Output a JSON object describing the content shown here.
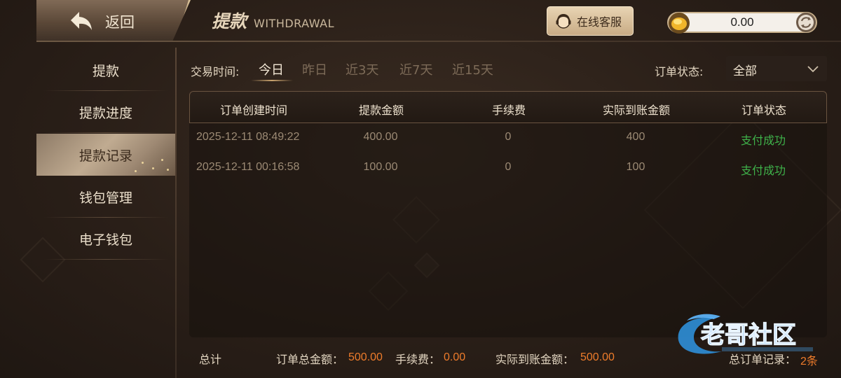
{
  "header": {
    "back_label": "返回",
    "title_cn": "提款",
    "title_en": "WITHDRAWAL",
    "service_label": "在线客服",
    "balance": "0.00"
  },
  "sidebar": {
    "items": [
      {
        "label": "提款"
      },
      {
        "label": "提款进度"
      },
      {
        "label": "提款记录"
      },
      {
        "label": "钱包管理"
      },
      {
        "label": "电子钱包"
      }
    ],
    "active_index": 2
  },
  "filter": {
    "label": "交易时间:",
    "options": [
      "今日",
      "昨日",
      "近3天",
      "近7天",
      "近15天"
    ],
    "active_index": 0,
    "status_label": "订单状态:",
    "status_value": "全部"
  },
  "table": {
    "headers": [
      "订单创建时间",
      "提款金额",
      "手续费",
      "实际到账金额",
      "订单状态"
    ],
    "rows": [
      {
        "time": "2025-12-11 08:49:22",
        "amount": "400.00",
        "fee": "0",
        "actual": "400",
        "status": "支付成功"
      },
      {
        "time": "2025-12-11 00:16:58",
        "amount": "100.00",
        "fee": "0",
        "actual": "100",
        "status": "支付成功"
      }
    ]
  },
  "footer": {
    "total_label": "总计",
    "order_total_label": "订单总金额：",
    "order_total_value": "500.00",
    "fee_label": "手续费：",
    "fee_value": "0.00",
    "actual_label": "实际到账金额：",
    "actual_value": "500.00",
    "records_label": "总订单记录：",
    "records_value": "2条"
  },
  "watermark": {
    "text": "老哥社区"
  },
  "colors": {
    "success": "#3fb24a",
    "accent_orange": "#ee7c2b",
    "gold": "#c9a36e"
  }
}
